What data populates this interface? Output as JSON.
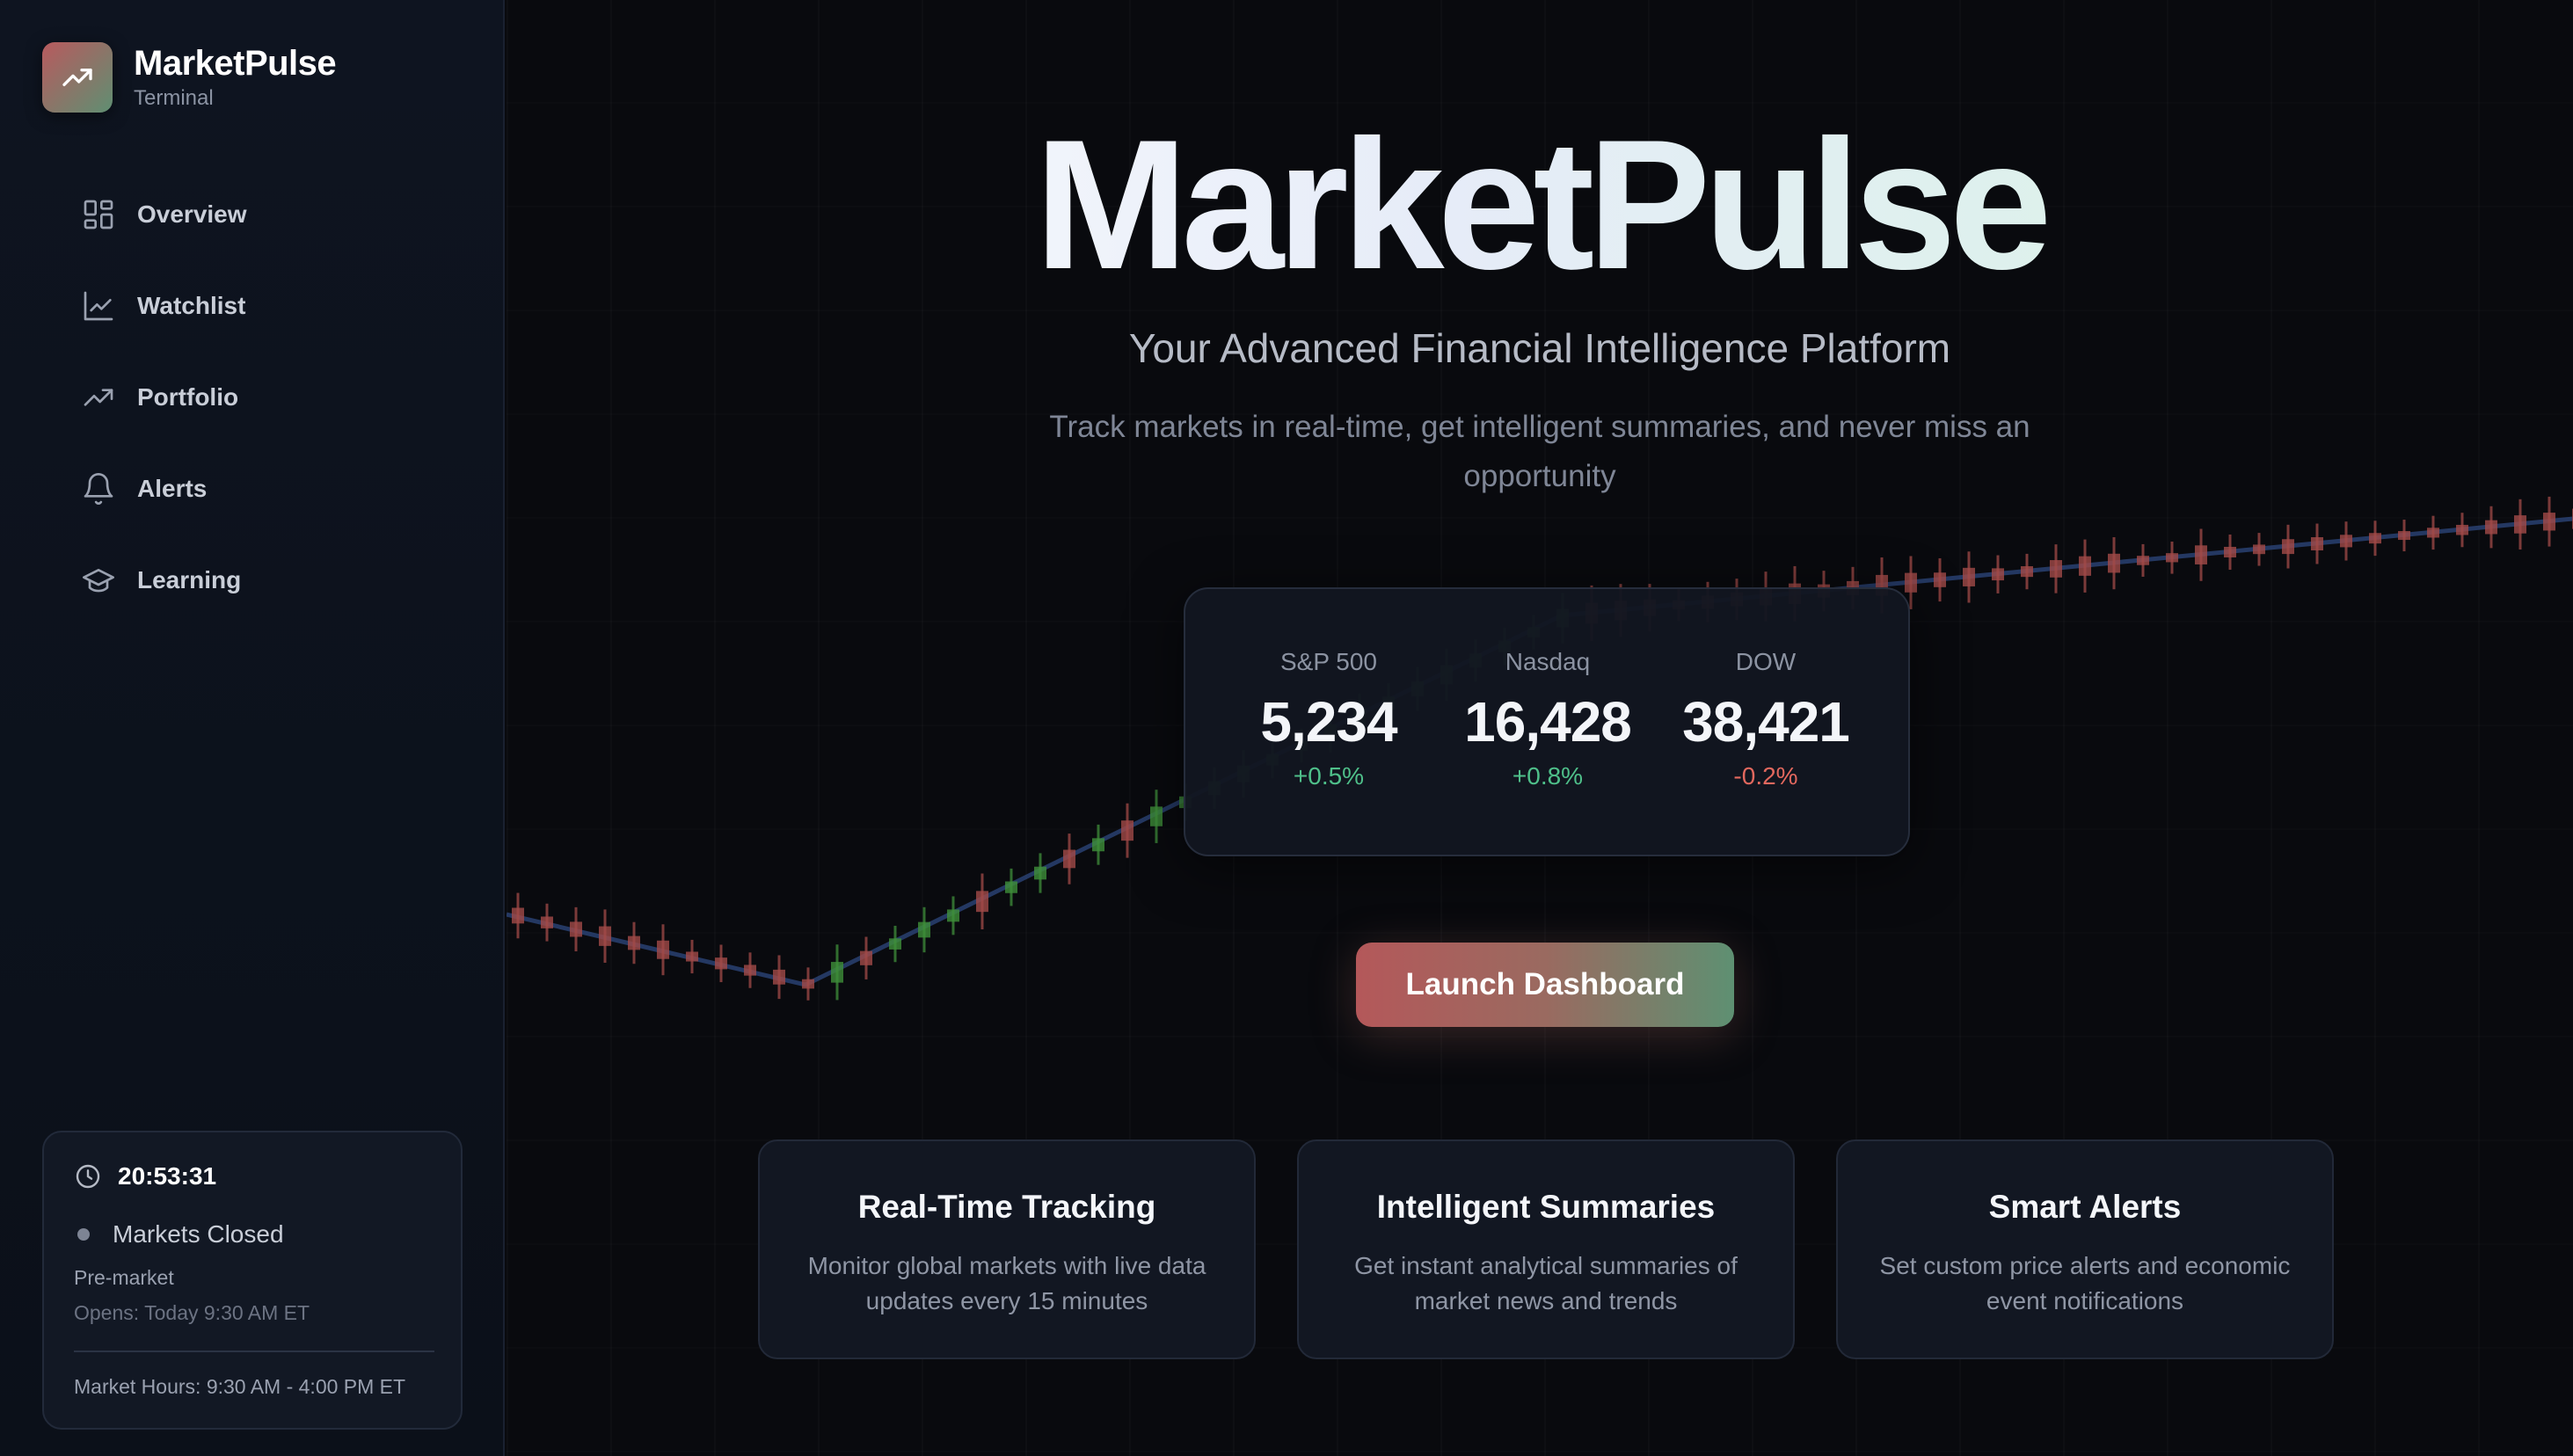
{
  "brand": {
    "title": "MarketPulse",
    "subtitle": "Terminal",
    "logo_icon": "trending-up-icon",
    "gradient": [
      "#b85a5e",
      "#5f8f72"
    ]
  },
  "nav": {
    "items": [
      {
        "label": "Overview",
        "icon": "grid-icon"
      },
      {
        "label": "Watchlist",
        "icon": "line-chart-icon"
      },
      {
        "label": "Portfolio",
        "icon": "trending-up-icon"
      },
      {
        "label": "Alerts",
        "icon": "bell-icon"
      },
      {
        "label": "Learning",
        "icon": "graduation-cap-icon"
      }
    ]
  },
  "status": {
    "time": "20:53:31",
    "market_state": "Markets Closed",
    "session": "Pre-market",
    "opens": "Opens: Today 9:30 AM ET",
    "hours": "Market Hours: 9:30 AM - 4:00 PM ET"
  },
  "hero": {
    "title": "MarketPulse",
    "subtitle": "Your Advanced Financial Intelligence Platform",
    "description": "Track markets in real-time, get intelligent summaries, and never miss an opportunity"
  },
  "indices": [
    {
      "name": "S&P 500",
      "value": "5,234",
      "change": "+0.5%",
      "direction": "up"
    },
    {
      "name": "Nasdaq",
      "value": "16,428",
      "change": "+0.8%",
      "direction": "up"
    },
    {
      "name": "DOW",
      "value": "38,421",
      "change": "-0.2%",
      "direction": "down"
    }
  ],
  "cta": {
    "label": "Launch Dashboard"
  },
  "features": [
    {
      "title": "Real-Time Tracking",
      "description": "Monitor global markets with live data updates every 15 minutes"
    },
    {
      "title": "Intelligent Summaries",
      "description": "Get instant analytical summaries of market news and trends"
    },
    {
      "title": "Smart Alerts",
      "description": "Set custom price alerts and economic event notifications"
    }
  ],
  "colors": {
    "positive": "#4fc08a",
    "negative": "#e2685e",
    "candle_up": "#3f8e3a",
    "candle_down": "#a24a48",
    "trend_line": "#3b5ea8"
  }
}
